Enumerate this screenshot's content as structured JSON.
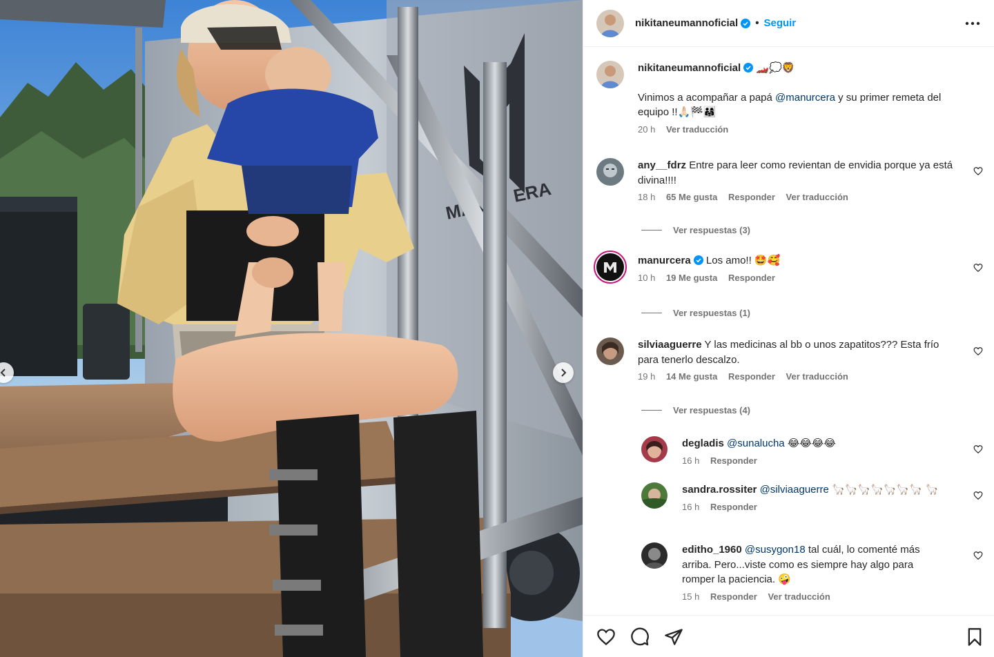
{
  "header": {
    "username": "nikitaneumannoficial",
    "separator": "•",
    "follow_label": "Seguir"
  },
  "caption": {
    "username": "nikitaneumannoficial",
    "title_emojis": "🏎️💭🦁",
    "text_prefix": "Vinimos a acompañar a papá ",
    "mention": "@manurcera",
    "text_suffix": " y su primer remeta del equipo !!🙏🏻🏁👨‍👩‍👧",
    "time": "20 h",
    "translate": "Ver traducción"
  },
  "comments": [
    {
      "username": "any__fdrz",
      "text": "Entre para leer como revientan de envidia porque ya está divina!!!!",
      "time": "18 h",
      "likes": "65 Me gusta",
      "reply": "Responder",
      "translate": "Ver traducción",
      "view_replies": "Ver respuestas (3)"
    },
    {
      "username": "manurcera",
      "text": "Los amo!! 🤩🥰",
      "time": "10 h",
      "likes": "19 Me gusta",
      "reply": "Responder",
      "view_replies": "Ver respuestas (1)"
    },
    {
      "username": "silviaaguerre",
      "text": "Y las medicinas al bb o unos zapatitos??? Esta frío para tenerlo descalzo.",
      "time": "19 h",
      "likes": "14 Me gusta",
      "reply": "Responder",
      "translate": "Ver traducción",
      "view_replies": "Ver respuestas (4)"
    }
  ],
  "replies": [
    {
      "username": "degladis",
      "mention": "@sunalucha",
      "text": "😂😂😂😂",
      "time": "16 h",
      "reply": "Responder"
    },
    {
      "username": "sandra.rossiter",
      "mention": "@silviaaguerre",
      "text": "🦙🦙🦙🦙🦙🦙🦙 🦙",
      "time": "16 h",
      "reply": "Responder"
    },
    {
      "username": "editho_1960",
      "mention": "@susygon18",
      "text": "tal cuál, lo comenté más arriba. Pero...viste como es siempre hay algo para romper la paciencia. 🤪",
      "time": "15 h",
      "reply": "Responder",
      "translate": "Ver traducción"
    }
  ],
  "photo": {
    "trailer_text_left": "MANU",
    "trailer_text_right": "ERA"
  },
  "icons": {
    "verified": "verified-badge-icon",
    "more": "more-options-icon",
    "like": "heart-icon",
    "comment": "comment-icon",
    "share": "share-icon",
    "save": "bookmark-icon"
  },
  "colors": {
    "accent": "#0095f6",
    "verified": "#0095f6",
    "mention": "#00376b",
    "muted": "#737373"
  }
}
